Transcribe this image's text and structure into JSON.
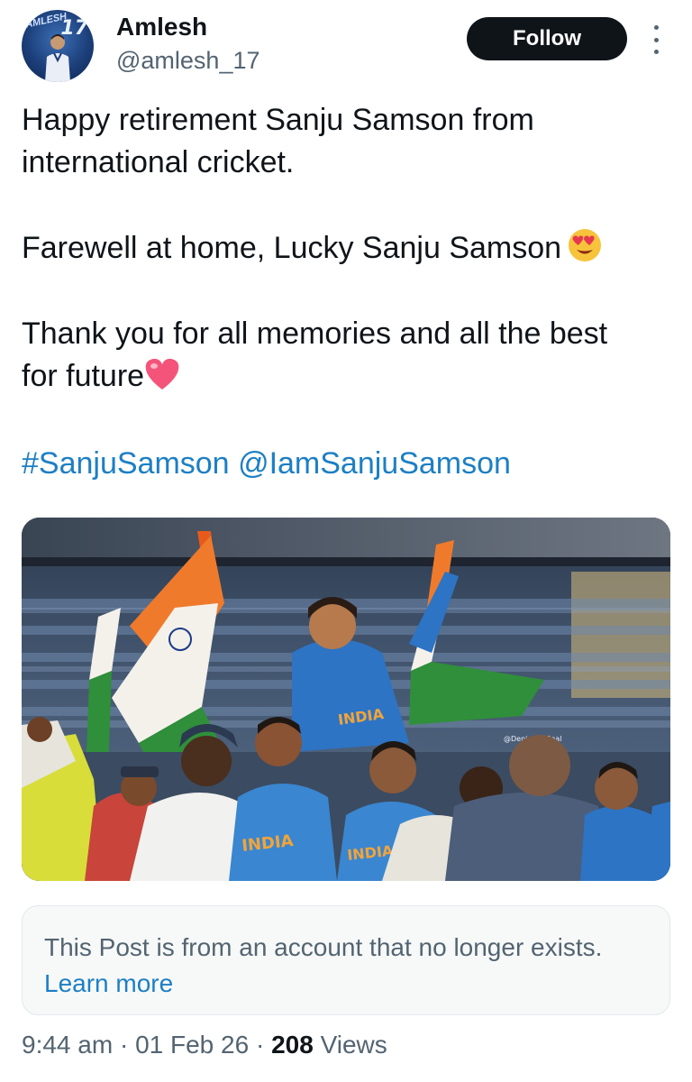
{
  "author": {
    "name": "Amlesh",
    "handle": "@amlesh_17",
    "avatar_text": "AMLESH",
    "avatar_number": "17"
  },
  "follow_button": "Follow",
  "more_icon": "more-vertical-icon",
  "tweet": {
    "line1a": "Happy retirement Sanju Samson from",
    "line1b": "international cricket.",
    "line2": "Farewell at home, Lucky Sanju Samson",
    "line3a": "Thank you for all memories and all the best",
    "line3b": "for future",
    "hashtag": "#SanjuSamson",
    "mention": "@IamSanjuSamson",
    "emoji_1": "heart-eyes-emoji",
    "emoji_2": "pink-heart-emoji"
  },
  "media": {
    "watermark": "@DenissForReal",
    "jersey_text_1": "INDIA",
    "jersey_text_2": "INDIA",
    "jersey_text_3": "INDIA"
  },
  "notice": {
    "text": "This Post is from an account that no longer exists.",
    "link": "Learn more"
  },
  "meta": {
    "time": "9:44 am",
    "date": "01 Feb 26",
    "views_count": "208",
    "views_label": "Views",
    "separator": "·"
  },
  "colors": {
    "link": "#1d7fc4",
    "text": "#0f1419",
    "muted": "#536471",
    "button_bg": "#0f1419"
  }
}
